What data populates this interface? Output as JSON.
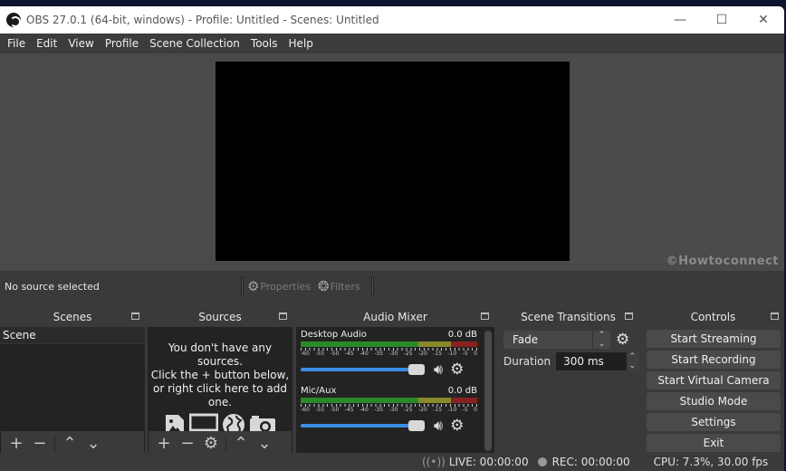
{
  "window": {
    "title": "OBS 27.0.1 (64-bit, windows) - Profile: Untitled - Scenes: Untitled",
    "minimize": "—",
    "maximize": "☐",
    "close": "✕"
  },
  "menu": [
    "File",
    "Edit",
    "View",
    "Profile",
    "Scene Collection",
    "Tools",
    "Help"
  ],
  "watermark": "©Howtoconnect",
  "source_toolbar": {
    "status": "No source selected",
    "properties": "Properties",
    "filters": "Filters"
  },
  "scenes": {
    "title": "Scenes",
    "items": [
      "Scene"
    ]
  },
  "sources": {
    "title": "Sources",
    "empty_line1": "You don't have any sources.",
    "empty_line2": "Click the + button below,",
    "empty_line3": "or right click here to add one."
  },
  "audio_mixer": {
    "title": "Audio Mixer",
    "channels": [
      {
        "name": "Desktop Audio",
        "level": "0.0 dB",
        "volume_percent": 100
      },
      {
        "name": "Mic/Aux",
        "level": "0.0 dB",
        "volume_percent": 100
      }
    ],
    "scale": [
      "-60",
      "-55",
      "-50",
      "-45",
      "-40",
      "-35",
      "-30",
      "-25",
      "-20",
      "-15",
      "-10",
      "-5",
      "0"
    ]
  },
  "scene_transitions": {
    "title": "Scene Transitions",
    "selected": "Fade",
    "duration_label": "Duration",
    "duration_value": "300 ms"
  },
  "controls": {
    "title": "Controls",
    "buttons": [
      "Start Streaming",
      "Start Recording",
      "Start Virtual Camera",
      "Studio Mode",
      "Settings",
      "Exit"
    ]
  },
  "status": {
    "live": "LIVE: 00:00:00",
    "rec": "REC: 00:00:00",
    "cpu": "CPU: 7.3%, 30.00 fps"
  },
  "colors": {
    "meter_green": "#2a8a2a",
    "meter_yellow": "#8a8a2a",
    "meter_red": "#8a2020",
    "volume_slider": "#3a8ee6"
  }
}
